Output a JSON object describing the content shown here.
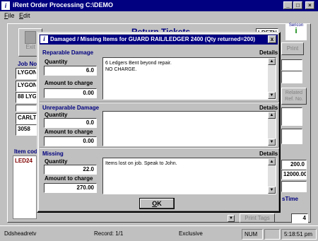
{
  "app": {
    "title": "iRent Order Processing     C:\\DEMO",
    "icon_letter": "i"
  },
  "menu": [
    {
      "label": "File",
      "hotkey": "F",
      "rest": "ile"
    },
    {
      "label": "Edit",
      "hotkey": "E",
      "rest": "dit"
    }
  ],
  "background": {
    "exit_label": "Exit",
    "print_label": "Print",
    "heading": "Return Tickets",
    "ref_label": "LRETN",
    "job_no_label": "Job No",
    "job_fields": [
      "LYGON",
      "LYGON",
      "88 LYGON",
      "",
      "CARLT",
      "3058"
    ],
    "related_ref_label": "Related Ref. No.",
    "item_code_label": "Item cod",
    "item_code_value": "LED24",
    "right_values": [
      "200.0",
      "12000.00"
    ],
    "time_label": "sTime",
    "print_tags_label": "Print Tags",
    "tag_count": "4",
    "sericon_label": "Sericon"
  },
  "dialog": {
    "title": "Damaged / Missing Items for  GUARD RAIL/LEDGER 2400 (Qty returned=200)",
    "close_glyph": "x",
    "icon_letter": "i",
    "details_label": "Details",
    "sections": [
      {
        "title": "Reparable Damage",
        "qty_label": "Quantity",
        "qty": "6.0",
        "amount_label": "Amount to charge",
        "amount": "0.00",
        "details": "6 Ledgers Bent beyond repair.\nNO CHARGE."
      },
      {
        "title": "Unreparable Damage",
        "qty_label": "Quantity",
        "qty": "0.0",
        "amount_label": "Amount to charge",
        "amount": "0.00",
        "details": ""
      },
      {
        "title": "Missing",
        "qty_label": "Quantity",
        "qty": "22.0",
        "amount_label": "Amount to charge",
        "amount": "270.00",
        "details": "Items lost on job. Speak to John."
      }
    ],
    "ok_hotkey": "O",
    "ok_rest": "K"
  },
  "status": {
    "user": "Ddsheadretv",
    "record": "Record: 1/1",
    "mode": "Exclusive",
    "num": "NUM",
    "time": "5:18:51 pm"
  },
  "colors": {
    "titlebar": "#000080",
    "face": "#c0c0c0",
    "section_title": "#000080",
    "item_code": "#800000"
  }
}
